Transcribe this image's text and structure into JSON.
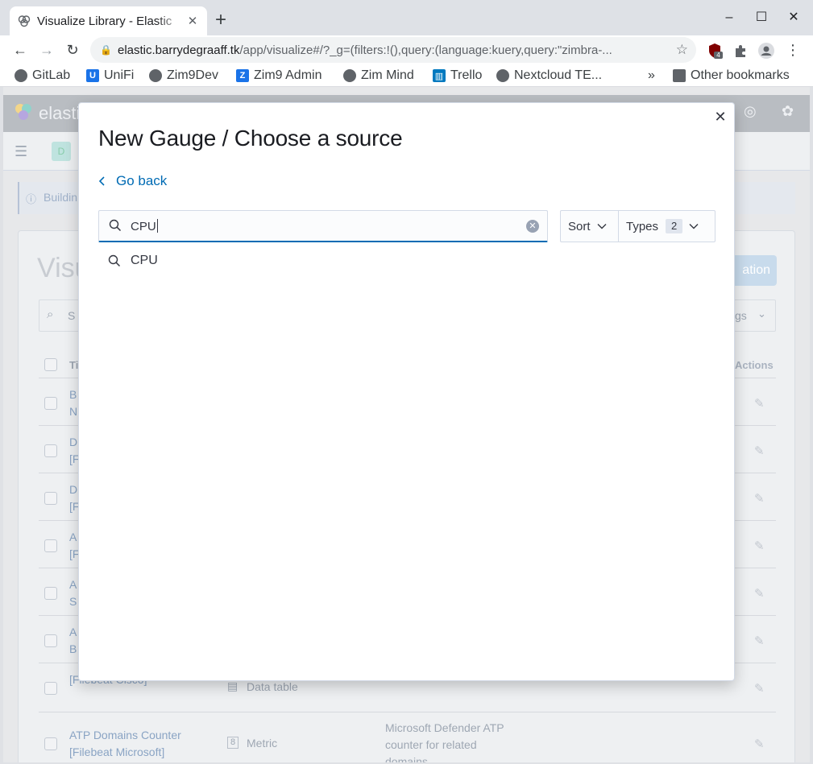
{
  "browser": {
    "tab_title": "Visualize Library - Elastic",
    "new_tab_symbol": "+",
    "url_host": "elastic.barrydegraaff.tk",
    "url_path": "/app/visualize#/?_g=(filters:!(),query:(language:kuery,query:\"zimbra-...",
    "extension_badge": "4",
    "bookmarks": [
      "GitLab",
      "UniFi",
      "Zim9Dev",
      "Zim9 Admin",
      "Zim Mind",
      "Trello",
      "Nextcloud TE..."
    ],
    "bookmarks_overflow": "»",
    "other_bookmarks": "Other bookmarks"
  },
  "background": {
    "app_name": "elastic",
    "space_initial": "D",
    "callout_text": "Buildin",
    "page_title_fragment": "Visu",
    "create_button_fragment": "ation",
    "search_placeholder_fragment": "S",
    "tags_fragment": "gs",
    "column_title": "Ti",
    "column_actions": "Actions",
    "rows": [
      {
        "l1": "B",
        "l2": "N"
      },
      {
        "l1": "D",
        "l2": "[F"
      },
      {
        "l1": "D",
        "l2": "[F"
      },
      {
        "l1": "A",
        "l2": "[F"
      },
      {
        "l1": "A",
        "l2": "S"
      },
      {
        "l1": "A",
        "l2": "B"
      },
      {
        "l1": "",
        "l2": "[Filebeat Cisco]",
        "type": "Data table"
      },
      {
        "l1": "ATP Domains Counter",
        "l2": "[Filebeat Microsoft]",
        "type": "Metric",
        "desc": [
          "Microsoft Defender ATP",
          "counter for related",
          "domains"
        ]
      }
    ]
  },
  "modal": {
    "title": "New Gauge / Choose a source",
    "go_back": "Go back",
    "search_value": "CPU",
    "sort_label": "Sort",
    "types_label": "Types",
    "types_count": "2",
    "suggestion": "CPU"
  },
  "colors": {
    "link": "#006bb4",
    "text": "#343741"
  }
}
